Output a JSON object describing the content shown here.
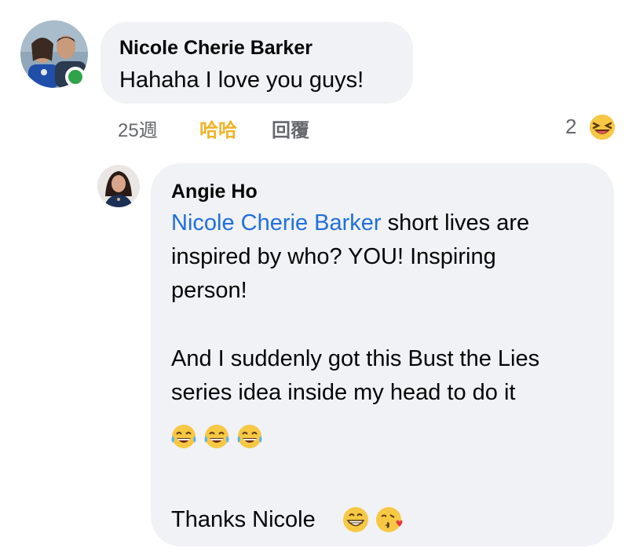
{
  "comment": {
    "author": "Nicole Cherie Barker",
    "text": "Hahaha I love you guys!",
    "time": "25週",
    "reaction_label": "哈哈",
    "reply_label": "回覆",
    "reaction_count": "2",
    "reaction_icon": "laughing-face-icon",
    "online_color": "#31a24c"
  },
  "reply": {
    "author": "Angie Ho",
    "mention": "Nicole Cherie Barker",
    "line1_rest": " short lives are",
    "line2": "inspired by who? YOU! Inspiring",
    "line3": "person!",
    "line4": "And I suddenly got this Bust the Lies",
    "line5": "series idea inside my head to do it",
    "emojis": [
      "tears-of-joy-icon",
      "tears-of-joy-icon",
      "tears-of-joy-icon"
    ],
    "closing": "Thanks Nicole",
    "closing_emojis": [
      "grinning-face-icon",
      "kissing-heart-face-icon"
    ],
    "mention_color": "#216fdb"
  }
}
